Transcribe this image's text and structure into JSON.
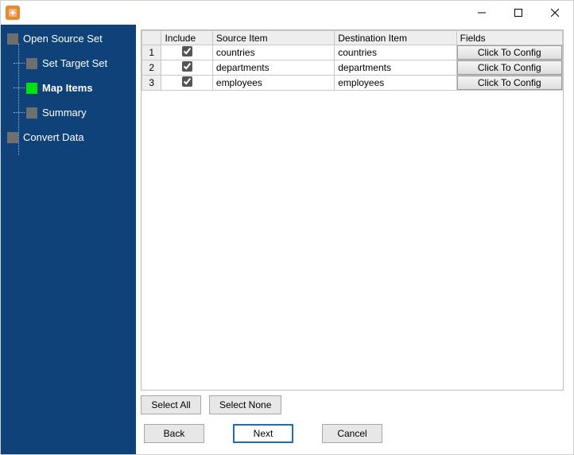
{
  "window": {
    "controls": {
      "min": "—",
      "max": "☐",
      "close": "✕"
    }
  },
  "sidebar": {
    "items": [
      {
        "label": "Open Source Set",
        "active": false,
        "child": false
      },
      {
        "label": "Set Target Set",
        "active": false,
        "child": true
      },
      {
        "label": "Map Items",
        "active": true,
        "child": true
      },
      {
        "label": "Summary",
        "active": false,
        "child": true
      },
      {
        "label": "Convert Data",
        "active": false,
        "child": false
      }
    ]
  },
  "table": {
    "headers": {
      "include": "Include",
      "source": "Source Item",
      "dest": "Destination Item",
      "fields": "Fields"
    },
    "config_button_label": "Click To Config",
    "rows": [
      {
        "n": "1",
        "include": true,
        "source": "countries",
        "dest": "countries"
      },
      {
        "n": "2",
        "include": true,
        "source": "departments",
        "dest": "departments"
      },
      {
        "n": "3",
        "include": true,
        "source": "employees",
        "dest": "employees"
      }
    ]
  },
  "buttons": {
    "select_all": "Select All",
    "select_none": "Select None",
    "back": "Back",
    "next": "Next",
    "cancel": "Cancel"
  }
}
